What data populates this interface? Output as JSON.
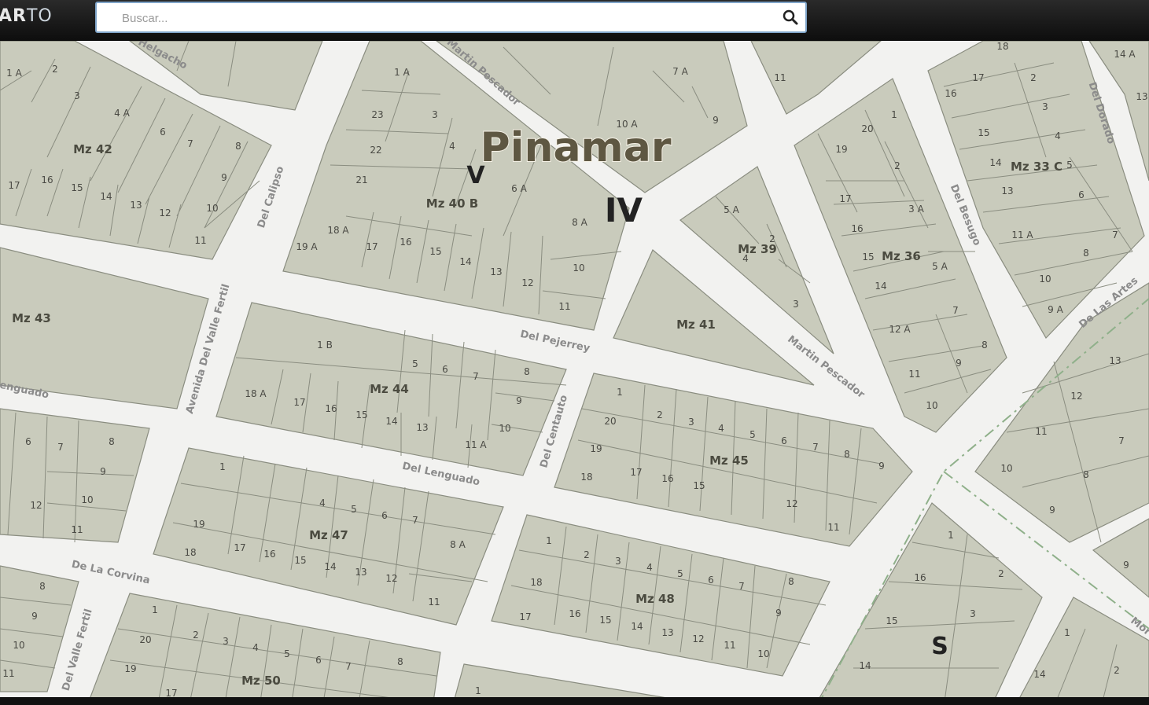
{
  "header": {
    "logo_bold": "AR",
    "logo_thin": "TO",
    "search_placeholder": "Buscar..."
  },
  "map": {
    "city": "Pinamar",
    "sectors": {
      "iv": "IV",
      "v": "V",
      "s": "S"
    },
    "streets": {
      "helgacho": "Helgacho",
      "martin_pescador_top": "Martin Pescador",
      "martin_pescador": "Martin Pescador",
      "del_calipso": "Del Calipso",
      "avenida_valle_fertil": "Avenida Del Valle Fertil",
      "del_pejerrey": "Del Pejerrey",
      "lenguado_left": "enguado",
      "del_lenguado": "Del Lenguado",
      "del_centauto": "Del Centauto",
      "de_la_corvina": "De La Corvina",
      "del_valle_fertil": "Del Valle Fertil",
      "del_besugo": "Del Besugo",
      "del_dorado": "Del Dorado",
      "de_las_artes": "De Las Artes",
      "mor": "Mor"
    },
    "manzanas": {
      "mz42": "Mz 42",
      "mz40b": "Mz 40 B",
      "mz43": "Mz 43",
      "mz39": "Mz 39",
      "mz41": "Mz 41",
      "mz36": "Mz 36",
      "mz33c": "Mz 33 C",
      "mz44": "Mz 44",
      "mz45": "Mz 45",
      "mz47": "Mz 47",
      "mz48": "Mz 48",
      "mz50": "Mz 50"
    },
    "colors": {
      "block": "#c9cbbc",
      "street": "#f2f2f0",
      "railway": "#8fb08a"
    }
  }
}
